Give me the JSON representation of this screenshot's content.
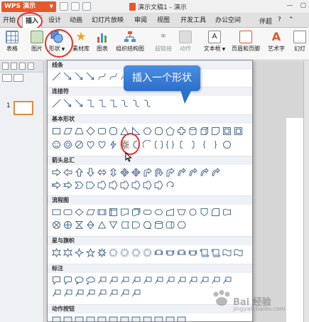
{
  "titlebar": {
    "app_name": "WPS 演示",
    "doc_title": "演示文稿1 - 演示"
  },
  "tabs": [
    "开始",
    "插入",
    "设计",
    "动画",
    "幻灯片放映",
    "审阅",
    "视图",
    "开发工具",
    "办公空间"
  ],
  "tabbar_right": {
    "user": "伴超"
  },
  "ribbon": {
    "table": "表格",
    "picture": "图片",
    "shapes": "形状",
    "material": "素材库",
    "chart": "图表",
    "org_chart": "组织结构图",
    "hyperlink": "超链接",
    "action": "动作",
    "textbox": "文本框",
    "header_footer": "页眉和页脚",
    "wordart": "艺术字",
    "slide": "幻灯"
  },
  "left_pane": {
    "slide_number": "1"
  },
  "dropdown": {
    "categories": [
      "线条",
      "连接符",
      "基本形状",
      "箭头总汇",
      "流程图",
      "星与旗帜",
      "标注",
      "动作按钮"
    ]
  },
  "callout": {
    "text": "插入一个形状"
  },
  "watermark": {
    "text": "Bai 经验",
    "url": "jingyan.baidu.com"
  },
  "colors": {
    "accent": "#e6582b",
    "highlight_circle": "#e8302b",
    "callout_blue": "#2c6fcd",
    "shape_stroke": "#4a6b8f"
  }
}
